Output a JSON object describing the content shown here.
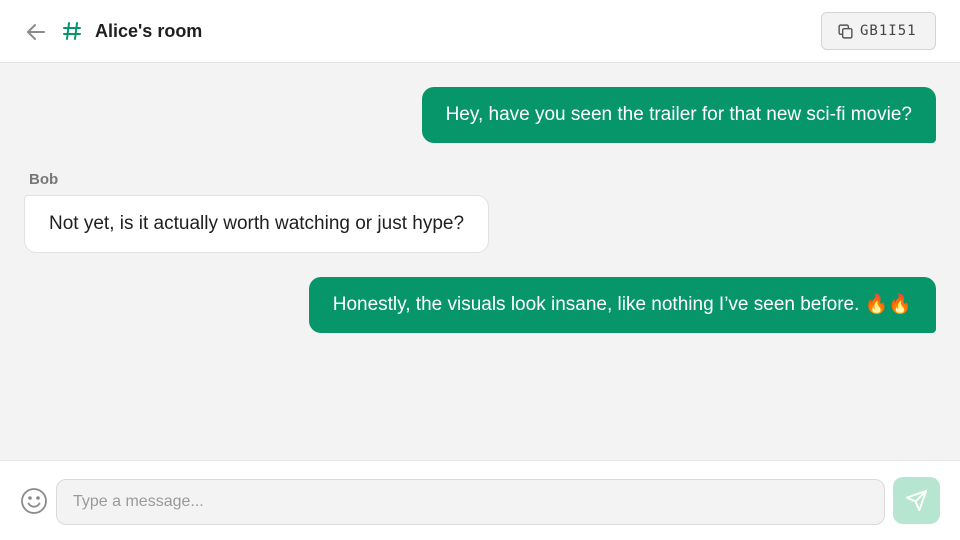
{
  "header": {
    "room_name": "Alice's room",
    "room_code": "GB1I51"
  },
  "messages": [
    {
      "direction": "outgoing",
      "text": "Hey, have you seen the trailer for that new sci-fi movie?"
    },
    {
      "direction": "incoming",
      "sender": "Bob",
      "text": "Not yet, is it actually worth watching or just hype?"
    },
    {
      "direction": "outgoing",
      "text": "Honestly, the visuals look insane, like nothing I’ve seen before. 🔥🔥"
    }
  ],
  "composer": {
    "placeholder": "Type a message..."
  },
  "colors": {
    "accent": "#079669",
    "send_button_disabled": "#b6e6d2"
  },
  "icons": [
    "back-arrow-icon",
    "hash-icon",
    "copy-icon",
    "emoji-icon",
    "send-icon"
  ]
}
